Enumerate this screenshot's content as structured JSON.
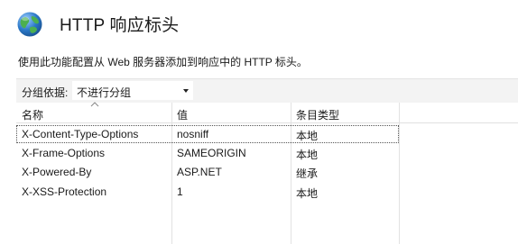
{
  "header": {
    "title": "HTTP 响应标头",
    "description": "使用此功能配置从 Web 服务器添加到响应中的 HTTP 标头。"
  },
  "toolbar": {
    "group_label": "分组依据:",
    "group_value": "不进行分组"
  },
  "grid": {
    "columns": [
      "名称",
      "值",
      "条目类型"
    ],
    "rows": [
      {
        "name": "X-Content-Type-Options",
        "value": "nosniff",
        "type": "本地"
      },
      {
        "name": "X-Frame-Options",
        "value": "SAMEORIGIN",
        "type": "本地"
      },
      {
        "name": "X-Powered-By",
        "value": "ASP.NET",
        "type": "继承"
      },
      {
        "name": "X-XSS-Protection",
        "value": "1",
        "type": "本地"
      }
    ]
  },
  "colors": {
    "toolbar_bg": "#f3f3f3",
    "grid_line": "#e2e2e2",
    "globe_blue": "#2b78c8",
    "globe_green": "#4caf50"
  },
  "icons": {
    "header": "globe-icon",
    "dropdown": "chevron-down-icon",
    "sort": "sort-arrow-icon"
  }
}
